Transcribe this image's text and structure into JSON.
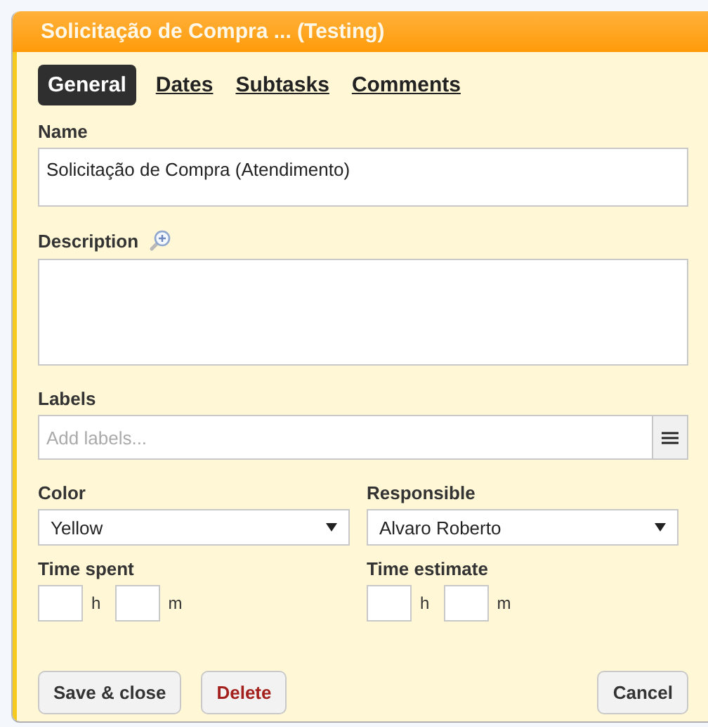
{
  "window": {
    "title": "Solicitação de Compra ... (Testing)"
  },
  "tabs": [
    {
      "label": "General",
      "selected": true
    },
    {
      "label": "Dates",
      "selected": false
    },
    {
      "label": "Subtasks",
      "selected": false
    },
    {
      "label": "Comments",
      "selected": false
    }
  ],
  "name": {
    "label": "Name",
    "value": "Solicitação de Compra (Atendimento)"
  },
  "description": {
    "label": "Description"
  },
  "labels": {
    "label": "Labels",
    "placeholder": "Add labels..."
  },
  "color": {
    "label": "Color",
    "value": "Yellow"
  },
  "responsible": {
    "label": "Responsible",
    "value": "Alvaro Roberto"
  },
  "time_spent": {
    "label": "Time spent",
    "units": [
      "h",
      "m"
    ]
  },
  "time_estimate": {
    "label": "Time estimate",
    "units": [
      "h",
      "m"
    ]
  },
  "buttons": [
    {
      "label": "Save & close",
      "kind": "primary"
    },
    {
      "label": "Delete",
      "kind": "danger"
    },
    {
      "label": "Cancel",
      "kind": "cancel"
    }
  ]
}
